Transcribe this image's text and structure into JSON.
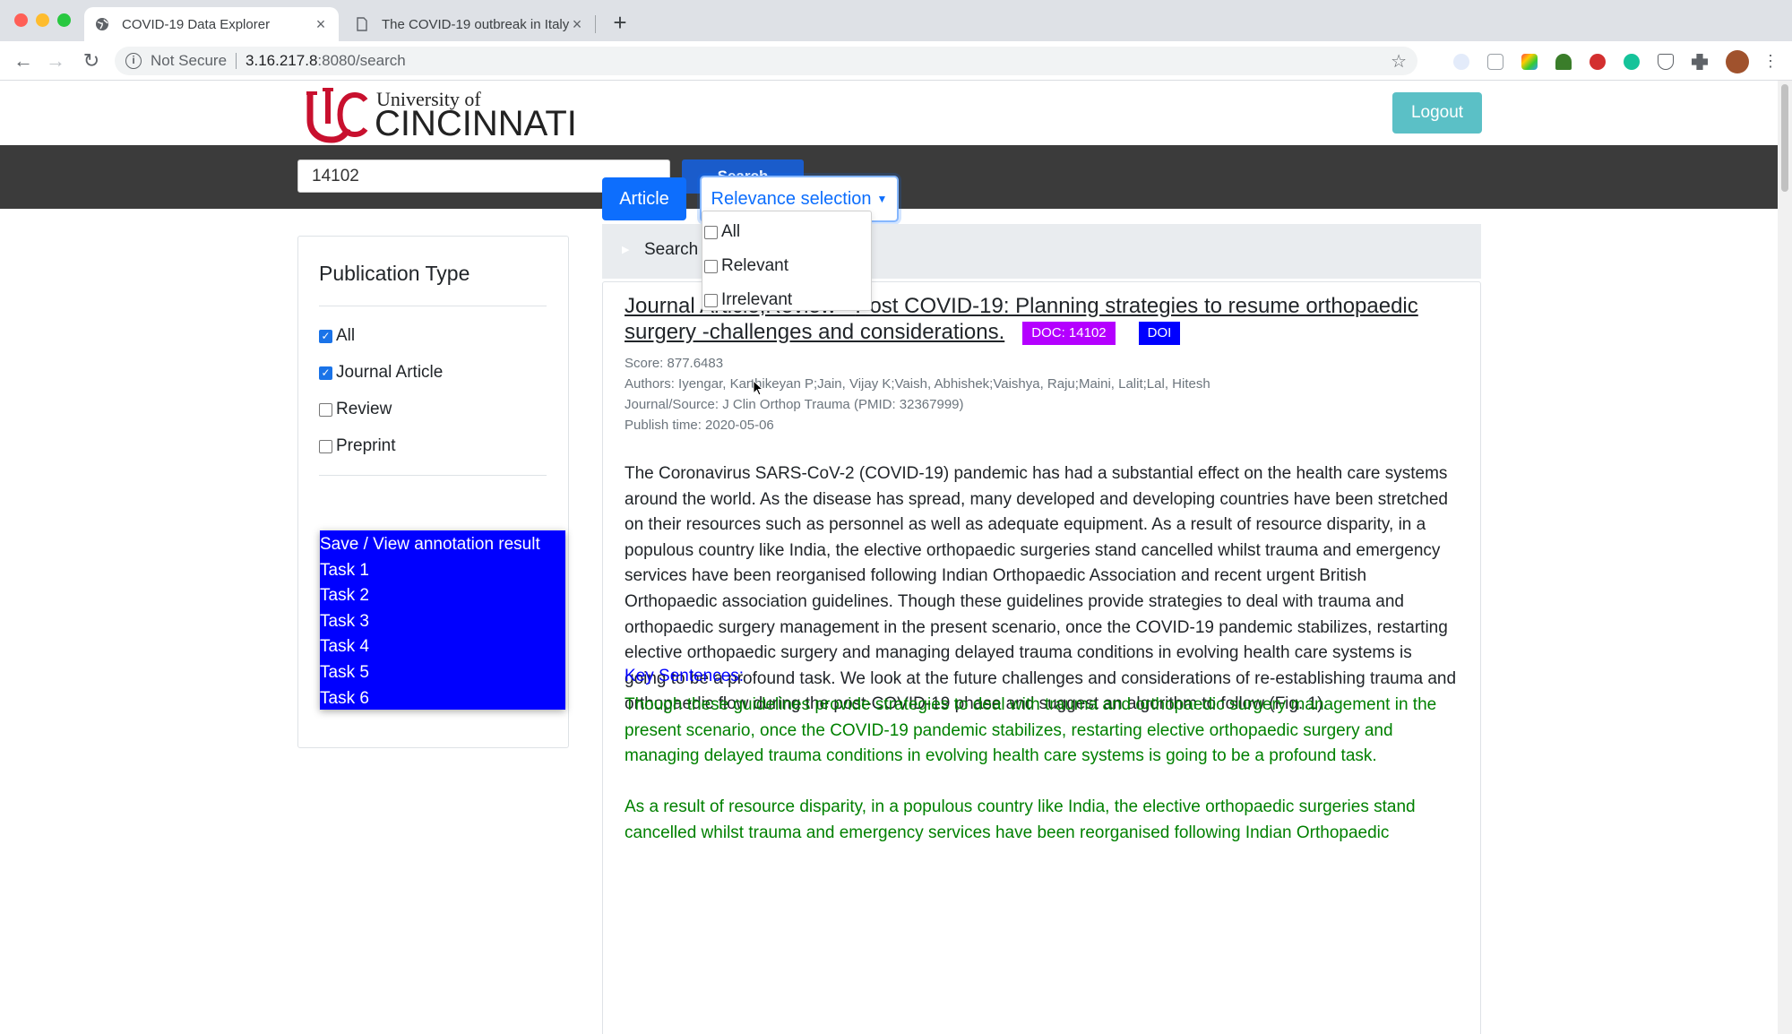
{
  "browser": {
    "tabs": [
      {
        "title": "COVID-19 Data Explorer",
        "active": true,
        "icon": "globe-icon"
      },
      {
        "title": "The COVID-19 outbreak in Italy",
        "active": false,
        "icon": "document-icon"
      }
    ],
    "url": {
      "security": "Not Secure",
      "host": "3.16.217.8",
      "rest": ":8080/search"
    }
  },
  "header": {
    "logo": {
      "line1": "University of",
      "line2": "CINCINNATI"
    },
    "logout_label": "Logout"
  },
  "search": {
    "value": "14102",
    "button_label": "Search"
  },
  "sidebar": {
    "title": "Publication Type",
    "filters": [
      {
        "label": "All",
        "checked": true
      },
      {
        "label": "Journal Article",
        "checked": true
      },
      {
        "label": "Review",
        "checked": false
      },
      {
        "label": "Preprint",
        "checked": false
      }
    ],
    "tasks": [
      "Save / View annotation result",
      "Task 1",
      "Task 2",
      "Task 3",
      "Task 4",
      "Task 5",
      "Task 6"
    ]
  },
  "main": {
    "article_label": "Article",
    "relevance_label": "Relevance selection",
    "relevance_options": [
      "All",
      "Relevant",
      "Irrelevant"
    ],
    "search_panel_label": "Search",
    "result": {
      "title_visible_start": "Journal Article;Review - ",
      "title_main": "Post COVID-19: Planning strategies to resume orthopaedic surgery -challenges and considerations.",
      "doc_badge": "DOC: 14102",
      "doi_badge": "DOI",
      "score": "Score: 877.6483",
      "authors": "Authors: Iyengar, Karthikeyan P;Jain, Vijay K;Vaish, Abhishek;Vaishya, Raju;Maini, Lalit;Lal, Hitesh",
      "journal": "Journal/Source: J Clin Orthop Trauma (PMID: 32367999)",
      "publish_time": "Publish time: 2020-05-06",
      "abstract": "The Coronavirus SARS-CoV-2 (COVID-19) pandemic has had a substantial effect on the health care systems around the world. As the disease has spread, many developed and developing countries have been stretched on their resources such as personnel as well as adequate equipment. As a result of resource disparity, in a populous country like India, the elective orthopaedic surgeries stand cancelled whilst trauma and emergency services have been reorganised following Indian Orthopaedic Association and recent urgent British Orthopaedic association guidelines. Though these guidelines provide strategies to deal with trauma and orthopaedic surgery management in the present scenario, once the COVID-19 pandemic stabilizes, restarting elective orthopaedic surgery and managing delayed trauma conditions in evolving health care systems is going to be a profound task. We look at the future challenges and considerations of re-establishing trauma and orthopaedic flow during the post-COVID-19 phase and suggest an algorithm to follow (Fig. 1).",
      "key_label": "Key Sentences:",
      "key_sentences": [
        "Though these guidelines provide strategies to deal with trauma and orthopaedic surgery management in the present scenario, once the COVID-19 pandemic stabilizes, restarting elective orthopaedic surgery and managing delayed trauma conditions in evolving health care systems is going to be a profound task.",
        "As a result of resource disparity, in a populous country like India, the elective orthopaedic surgeries stand cancelled whilst trauma and emergency services have been reorganised following Indian Orthopaedic"
      ]
    }
  },
  "colors": {
    "accent": "#0d6efd",
    "search_btn": "#1a5ccb",
    "task_box": "#0000ff",
    "doc_badge": "#b400ff",
    "key_green": "#008000",
    "logout": "#5bc0c6"
  }
}
